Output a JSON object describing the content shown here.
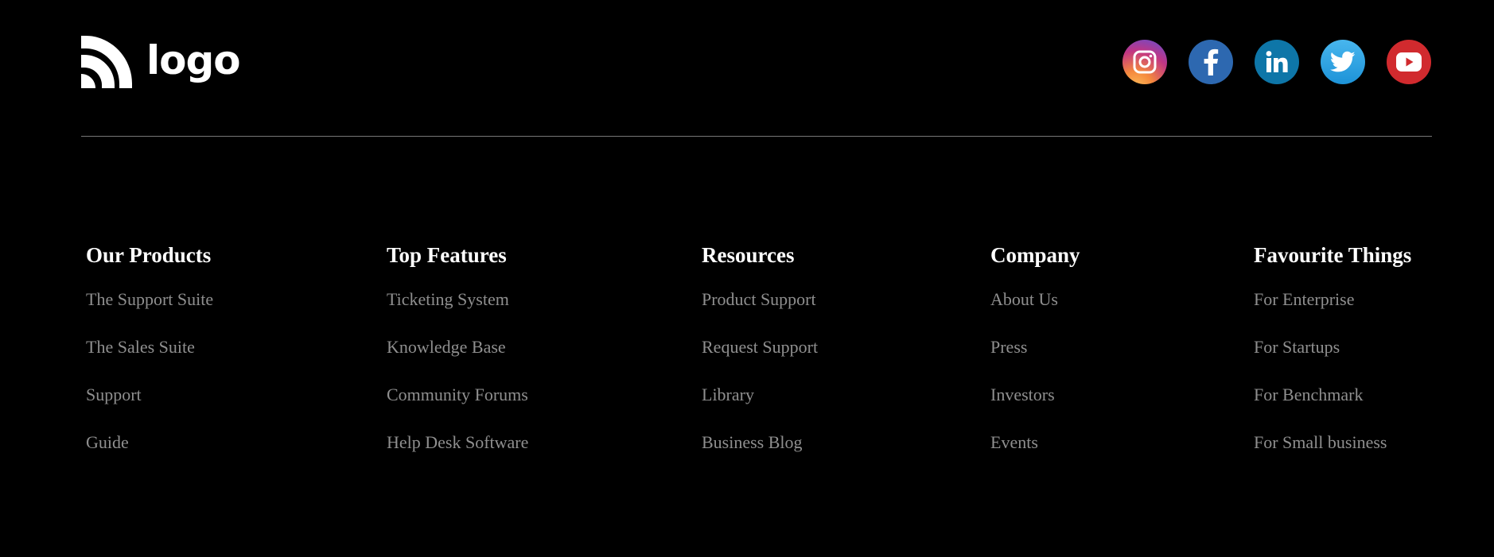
{
  "logo": {
    "text": "logo"
  },
  "socials": [
    {
      "name": "instagram",
      "icon": "instagram-icon",
      "color": "#c13584"
    },
    {
      "name": "facebook",
      "icon": "facebook-icon",
      "color": "#2d68b0"
    },
    {
      "name": "linkedin",
      "icon": "linkedin-icon",
      "color": "#0e76a8"
    },
    {
      "name": "twitter",
      "icon": "twitter-icon",
      "color": "#2ea4e4"
    },
    {
      "name": "youtube",
      "icon": "youtube-icon",
      "color": "#d12a2e"
    }
  ],
  "columns": [
    {
      "heading": "Our Products",
      "links": [
        "The Support Suite",
        "The Sales Suite",
        "Support",
        "Guide"
      ]
    },
    {
      "heading": "Top Features",
      "links": [
        "Ticketing System",
        "Knowledge Base",
        "Community Forums",
        "Help Desk Software"
      ]
    },
    {
      "heading": "Resources",
      "links": [
        "Product Support",
        "Request Support",
        "Library",
        "Business Blog"
      ]
    },
    {
      "heading": "Company",
      "links": [
        "About Us",
        "Press",
        "Investors",
        "Events"
      ]
    },
    {
      "heading": "Favourite Things",
      "links": [
        "For Enterprise",
        "For Startups",
        "For Benchmark",
        "For Small business"
      ]
    }
  ],
  "colors": {
    "background": "#000000",
    "heading": "#ffffff",
    "link": "#8f8f8f",
    "divider": "#777777"
  }
}
